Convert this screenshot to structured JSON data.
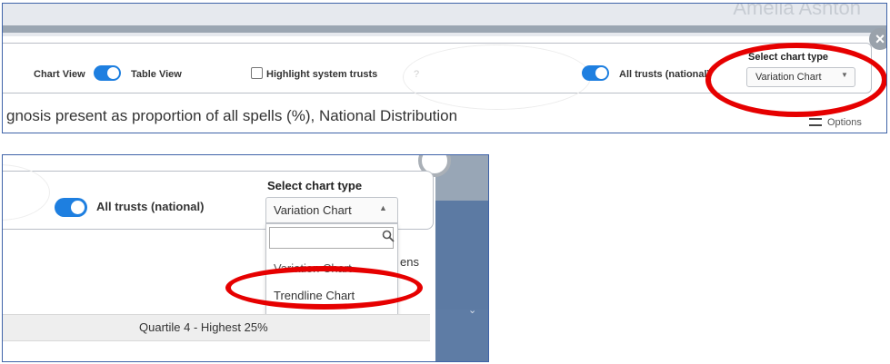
{
  "panel1": {
    "user_name": "Amelia Ashton",
    "chart_view_label": "Chart View",
    "table_view_label": "Table View",
    "highlight_label": "Highlight system trusts",
    "all_trusts_label": "All trusts (national)",
    "select_chart_label": "Select chart type",
    "select_chart_value": "Variation Chart",
    "chart_title": "gnosis present as proportion of all spells (%), National Distribution",
    "options_label": "Options",
    "close_icon": "close-icon",
    "accent_color": "#1e7fe0",
    "highlight_color": "#e60000"
  },
  "panel2": {
    "all_trusts_label": "All trusts (national)",
    "select_chart_label": "Select chart type",
    "select_chart_value": "Variation Chart",
    "search_placeholder": "",
    "options": [
      "Variation Chart",
      "Trendline Chart"
    ],
    "partial_text": "ens",
    "quartile_label": "Quartile 4 - Highest 25%"
  }
}
